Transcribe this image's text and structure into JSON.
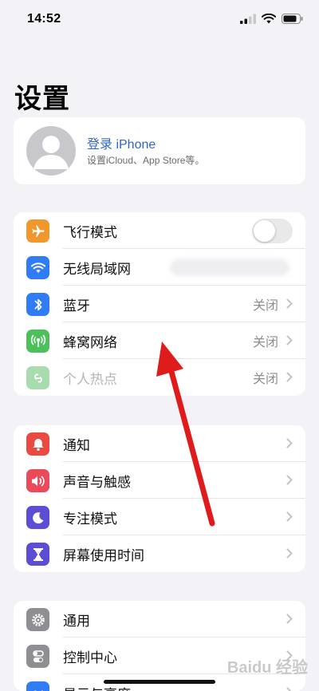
{
  "status_bar": {
    "time": "14:52"
  },
  "page": {
    "title": "设置"
  },
  "profile": {
    "name": "登录 iPhone",
    "subtitle": "设置iCloud、App Store等。"
  },
  "group1": [
    {
      "label": "飞行模式",
      "icon": "airplane-icon",
      "color": "#f0982e",
      "toggle": false
    },
    {
      "label": "无线局域网",
      "icon": "wifi-icon",
      "color": "#2f7cf6"
    },
    {
      "label": "蓝牙",
      "icon": "bluetooth-icon",
      "color": "#2f7cf6",
      "value": "关闭"
    },
    {
      "label": "蜂窝网络",
      "icon": "cellular-icon",
      "color": "#4cc05a",
      "value": "关闭"
    },
    {
      "label": "个人热点",
      "icon": "hotspot-icon",
      "color": "#a8dcae",
      "value": "关闭"
    }
  ],
  "group2": [
    {
      "label": "通知",
      "icon": "notification-icon",
      "color": "#ea4a3f"
    },
    {
      "label": "声音与触感",
      "icon": "sound-icon",
      "color": "#ea4a5a"
    },
    {
      "label": "专注模式",
      "icon": "moon-icon",
      "color": "#5b4dd4"
    },
    {
      "label": "屏幕使用时间",
      "icon": "hourglass-icon",
      "color": "#5b4dd4"
    }
  ],
  "group3": [
    {
      "label": "通用",
      "icon": "gear-icon",
      "color": "#8e8e93"
    },
    {
      "label": "控制中心",
      "icon": "control-center-icon",
      "color": "#8e8e93"
    },
    {
      "label": "显示与亮度",
      "icon": "display-icon",
      "color": "#2f7cf6"
    }
  ],
  "watermark": "Baidu 经验",
  "annotation": {
    "color": "#e01b1b"
  }
}
